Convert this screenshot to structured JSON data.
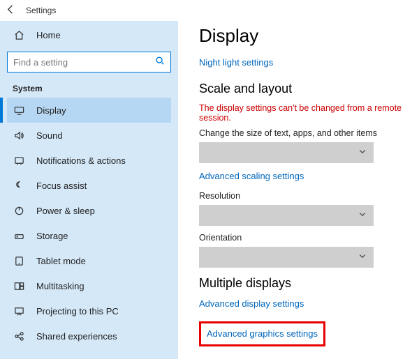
{
  "titlebar": {
    "app_name": "Settings"
  },
  "sidebar": {
    "home_label": "Home",
    "search_placeholder": "Find a setting",
    "section_label": "System",
    "items": [
      {
        "label": "Display"
      },
      {
        "label": "Sound"
      },
      {
        "label": "Notifications & actions"
      },
      {
        "label": "Focus assist"
      },
      {
        "label": "Power & sleep"
      },
      {
        "label": "Storage"
      },
      {
        "label": "Tablet mode"
      },
      {
        "label": "Multitasking"
      },
      {
        "label": "Projecting to this PC"
      },
      {
        "label": "Shared experiences"
      }
    ]
  },
  "content": {
    "title": "Display",
    "night_light_link": "Night light settings",
    "scale_heading": "Scale and layout",
    "remote_error": "The display settings can't be changed from a remote session.",
    "scale_desc": "Change the size of text, apps, and other items",
    "advanced_scaling_link": "Advanced scaling settings",
    "resolution_label": "Resolution",
    "orientation_label": "Orientation",
    "multiple_heading": "Multiple displays",
    "advanced_display_link": "Advanced display settings",
    "advanced_graphics_link": "Advanced graphics settings"
  }
}
